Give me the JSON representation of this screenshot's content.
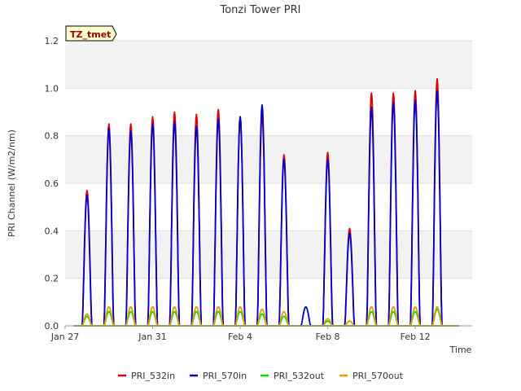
{
  "chart_data": {
    "type": "line",
    "title": "Tonzi Tower PRI",
    "xlabel": "Time",
    "ylabel": "PRI Channel (W/m2/nm)",
    "tag": "TZ_tmet",
    "ylim": [
      0,
      1.2
    ],
    "yticks": [
      0.0,
      0.2,
      0.4,
      0.6,
      0.8,
      1.0,
      1.2
    ],
    "ytick_labels": [
      "0.0",
      "0.2",
      "0.4",
      "0.6",
      "0.8",
      "1.0",
      "1.2"
    ],
    "xlim_days": [
      0,
      18.6
    ],
    "xticks": [
      {
        "day": 0,
        "label": "Jan 27"
      },
      {
        "day": 4,
        "label": "Jan 31"
      },
      {
        "day": 8,
        "label": "Feb 4"
      },
      {
        "day": 12,
        "label": "Feb 8"
      },
      {
        "day": 16,
        "label": "Feb 12"
      }
    ],
    "grid": "horizontal bands",
    "legend_position": "bottom",
    "series": [
      {
        "name": "PRI_532in",
        "color": "#dd0000",
        "peaks": [
          0.57,
          0.85,
          0.85,
          0.88,
          0.9,
          0.89,
          0.91,
          0.88,
          0.89,
          0.72,
          0.0,
          0.73,
          0.41,
          0.98,
          0.98,
          0.99,
          1.04
        ]
      },
      {
        "name": "PRI_570in",
        "color": "#0000cc",
        "peaks": [
          0.55,
          0.83,
          0.82,
          0.85,
          0.86,
          0.84,
          0.87,
          0.88,
          0.93,
          0.7,
          0.08,
          0.7,
          0.39,
          0.92,
          0.94,
          0.95,
          0.99
        ]
      },
      {
        "name": "PRI_532out",
        "color": "#00dd00",
        "peaks": [
          0.04,
          0.06,
          0.06,
          0.06,
          0.06,
          0.06,
          0.06,
          0.06,
          0.05,
          0.04,
          0.0,
          0.02,
          0.02,
          0.06,
          0.06,
          0.06,
          0.07
        ]
      },
      {
        "name": "PRI_570out",
        "color": "#e0a000",
        "peaks": [
          0.05,
          0.08,
          0.08,
          0.08,
          0.08,
          0.08,
          0.08,
          0.08,
          0.07,
          0.06,
          0.0,
          0.03,
          0.02,
          0.08,
          0.08,
          0.08,
          0.08
        ]
      }
    ],
    "peak_days": [
      1.0,
      2.0,
      3.0,
      4.0,
      5.0,
      6.0,
      7.0,
      8.0,
      9.0,
      10.0,
      11.0,
      12.0,
      13.0,
      14.0,
      15.0,
      16.0,
      17.0
    ]
  }
}
